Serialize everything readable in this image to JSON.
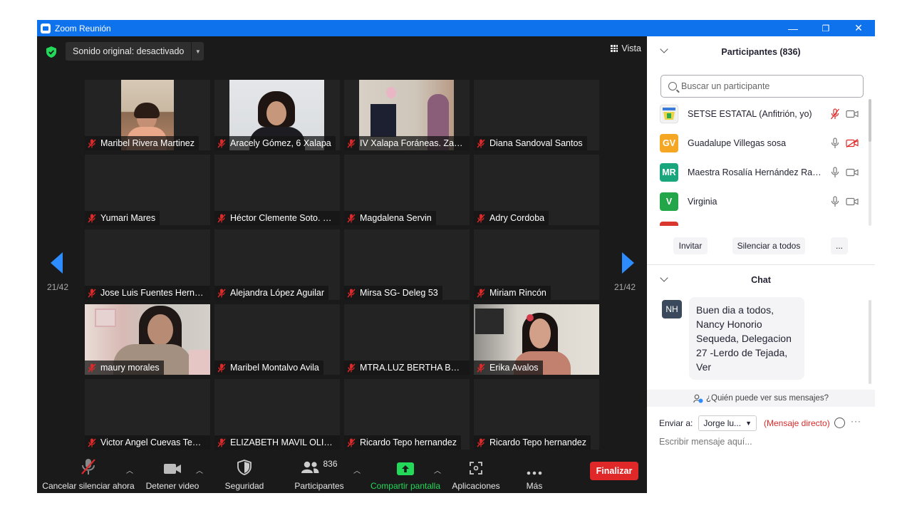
{
  "window": {
    "title": "Zoom Reunión",
    "minimize": "—",
    "maximize": "❐",
    "close": "✕"
  },
  "topbar": {
    "sound_label": "Sonido original: desactivado",
    "view_label": "Vista"
  },
  "pager": {
    "left": "21/42",
    "right": "21/42"
  },
  "tiles": [
    {
      "name": "Maribel Rivera Martinez",
      "video": true,
      "muted": true
    },
    {
      "name": "Aracely Gómez,  6 Xalapa",
      "video": true,
      "muted": true
    },
    {
      "name": "IV Xalapa Foráneas. Zaragoza",
      "video": true,
      "muted": true
    },
    {
      "name": "Diana Sandoval Santos",
      "video": false,
      "muted": true
    },
    {
      "name": "Yumari Mares",
      "video": false,
      "muted": true
    },
    {
      "name": "Héctor Clemente Soto. Deleg",
      "video": false,
      "muted": true
    },
    {
      "name": "Magdalena Servin",
      "video": false,
      "muted": true
    },
    {
      "name": "Adry Cordoba",
      "video": false,
      "muted": true
    },
    {
      "name": "Jose Luis Fuentes Hernández",
      "video": false,
      "muted": true
    },
    {
      "name": "Alejandra López Aguilar",
      "video": false,
      "muted": true
    },
    {
      "name": "Mirsa SG- Deleg 53",
      "video": false,
      "muted": true
    },
    {
      "name": "Miriam Rincón",
      "video": false,
      "muted": true
    },
    {
      "name": "maury morales",
      "video": true,
      "muted": true
    },
    {
      "name": "Maribel Montalvo Avila",
      "video": false,
      "muted": true
    },
    {
      "name": "MTRA.LUZ BERTHA BECERRA",
      "video": false,
      "muted": true
    },
    {
      "name": "Erika Avalos",
      "video": true,
      "muted": true
    },
    {
      "name": "Victor Angel Cuevas Tenorio",
      "video": false,
      "muted": true
    },
    {
      "name": "ELIZABETH MAVIL OLIVARES",
      "video": false,
      "muted": true
    },
    {
      "name": "Ricardo Tepo hernandez",
      "video": false,
      "muted": true
    },
    {
      "name": "Ricardo Tepo hernandez",
      "video": false,
      "muted": true
    }
  ],
  "toolbar": {
    "unmute": "Cancelar silenciar ahora",
    "stop_video": "Detener video",
    "security": "Seguridad",
    "participants": "Participantes",
    "participants_count": "836",
    "share": "Compartir pantalla",
    "apps": "Aplicaciones",
    "more": "Más",
    "end": "Finalizar"
  },
  "participants_panel": {
    "title": "Participantes (836)",
    "search_placeholder": "Buscar un participante",
    "list": [
      {
        "initials": "",
        "name": "SETSE ESTATAL (Anfitrión, yo)",
        "color": "#ffffff",
        "mic_muted": true,
        "cam_off": false
      },
      {
        "initials": "GV",
        "name": "Guadalupe Villegas sosa",
        "color": "#f5a623",
        "mic_muted": false,
        "cam_off": true
      },
      {
        "initials": "MR",
        "name": "Maestra Rosalía Hernández Ramírez",
        "color": "#1aa67d",
        "mic_muted": false,
        "cam_off": false
      },
      {
        "initials": "V",
        "name": "Virginia",
        "color": "#23a64a",
        "mic_muted": false,
        "cam_off": false
      }
    ],
    "invite": "Invitar",
    "mute_all": "Silenciar a todos",
    "more": "..."
  },
  "chat": {
    "title": "Chat",
    "sender_initials": "NH",
    "message": "Buen dia a todos, Nancy Honorio Sequeda, Delegacion 27 -Lerdo de Tejada, Ver",
    "who_sees": "¿Quién puede ver sus mensajes?",
    "send_to_label": "Enviar a:",
    "send_to_value": "Jorge lu...",
    "direct": "(Mensaje directo)",
    "more": "···",
    "input_placeholder": "Escribir mensaje aquí..."
  },
  "colors": {
    "zoom_blue": "#0e72ed",
    "accent_blue": "#2d8cff",
    "end_red": "#e02828",
    "share_green": "#23d959",
    "muted_red": "#e02828"
  }
}
